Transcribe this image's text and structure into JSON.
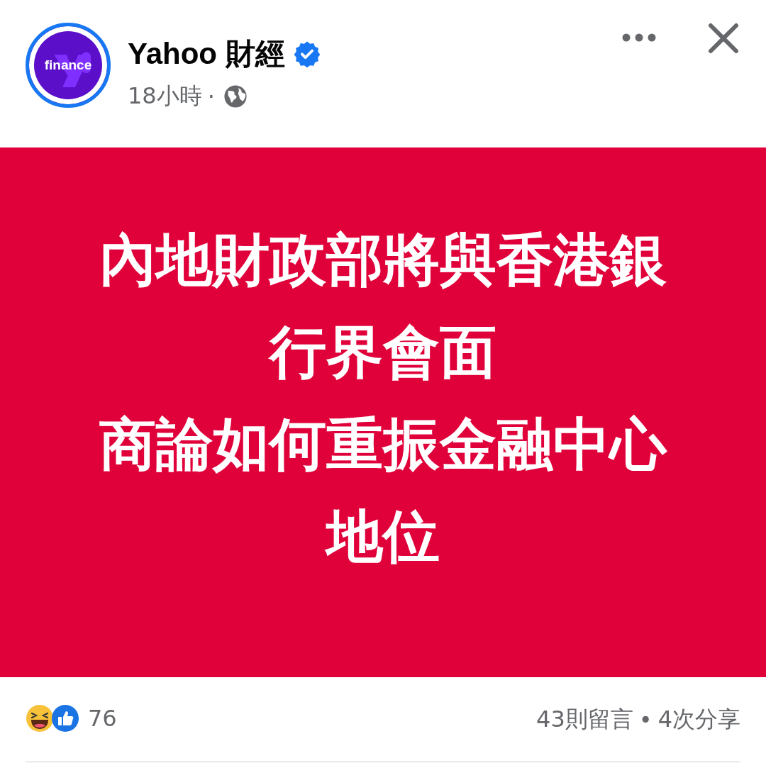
{
  "post": {
    "author": {
      "name": "Yahoo 財經",
      "verified": true,
      "avatar_label": "finance"
    },
    "time": "18小時",
    "separator": "·",
    "card": {
      "lines": [
        "內地財政部將與香港銀",
        "行界會面",
        "商論如何重振金融中心",
        "地位"
      ]
    },
    "reactions": {
      "count": "76"
    },
    "comments": "43則留言",
    "dot": "•",
    "shares": "4次分享"
  }
}
